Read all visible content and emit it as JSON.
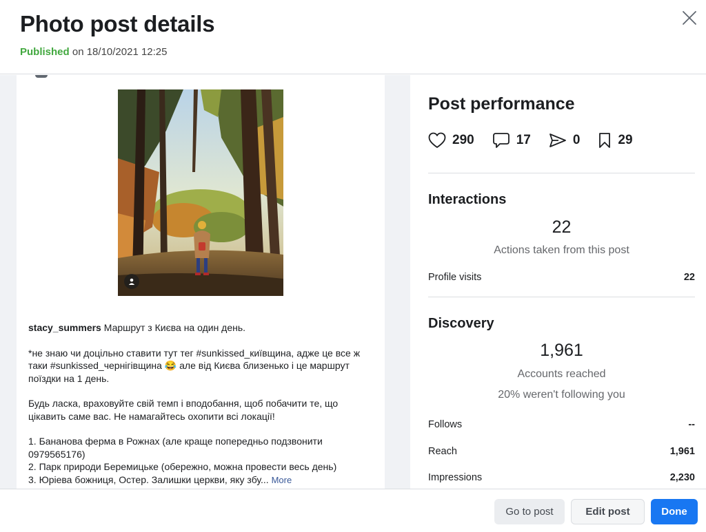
{
  "header": {
    "title": "Photo post details",
    "status": "Published",
    "date_text": "on 18/10/2021 12:25"
  },
  "post": {
    "username": "stacy_summers",
    "caption_first": "Маршрут з Києва на один день.",
    "paragraph2": "*не знаю чи доцільно ставити тут тег #sunkissed_київщина, адже це все ж таки #sunkissed_чернігівщина 😂 але від Києва близенько і це маршрут поїздки на 1 день.",
    "paragraph3": "Будь ласка, враховуйте свій темп і вподобання, щоб побачити те, що цікавить саме вас. Не намагайтесь охопити всі локації!",
    "list_item1": "1. Бананова ферма в Рожнах (але краще попередньо подзвонити 0979565176)",
    "list_item2": "2. Парк природи Беремицьке (обережно, можна провести весь день)",
    "list_item3": "3. Юріева божниця, Остер. Залишки церкви, яку збу...",
    "more_label": "More"
  },
  "performance": {
    "title": "Post performance",
    "likes": "290",
    "comments": "17",
    "shares": "0",
    "saves": "29"
  },
  "interactions": {
    "title": "Interactions",
    "total": "22",
    "subtitle": "Actions taken from this post",
    "profile_visits_label": "Profile visits",
    "profile_visits_value": "22"
  },
  "discovery": {
    "title": "Discovery",
    "total": "1,961",
    "subtitle": "Accounts reached",
    "not_following": "20% weren't following you",
    "follows_label": "Follows",
    "follows_value": "--",
    "reach_label": "Reach",
    "reach_value": "1,961",
    "impressions_label": "Impressions",
    "impressions_value": "2,230"
  },
  "footer": {
    "goto_label": "Go to post",
    "edit_label": "Edit post",
    "done_label": "Done"
  },
  "colors": {
    "published": "#42a83f",
    "primary": "#1877f2",
    "link": "#385898"
  }
}
